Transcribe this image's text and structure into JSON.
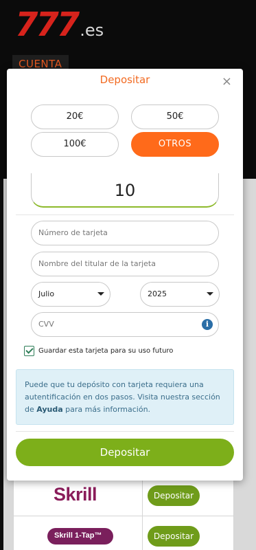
{
  "background": {
    "logo_number": "777",
    "logo_domain": ".es",
    "account_label": "CUENTA",
    "payment_methods": [
      {
        "name": "Skrill",
        "button_label": "Depositar"
      },
      {
        "name": "Skrill 1-Tap™",
        "button_label": "Depositar"
      }
    ]
  },
  "modal": {
    "title": "Depositar",
    "close_glyph": "×",
    "amount_options": [
      {
        "label": "20€",
        "selected": false
      },
      {
        "label": "50€",
        "selected": false
      },
      {
        "label": "100€",
        "selected": false
      },
      {
        "label": "OTROS",
        "selected": true
      }
    ],
    "amount_value": "10",
    "card_number_placeholder": "Número de tarjeta",
    "card_holder_placeholder": "Nombre del titular de la tarjeta",
    "expiry_month": "Julio",
    "expiry_year": "2025",
    "cvv_placeholder": "CVV",
    "save_card": {
      "checked": true,
      "label": "Guardar esta tarjeta para su uso futuro"
    },
    "info": {
      "text_before": "Puede que tu depósito con tarjeta requiera una autentificación en dos pasos. Visita nuestra sección de ",
      "help_link": "Ayuda",
      "text_after": " para más información."
    },
    "submit_label": "Depositar"
  },
  "colors": {
    "accent_orange": "#ff6a1a",
    "primary_green": "#7daf1a",
    "brand_red": "#d7231c",
    "info_blue": "#dff0f7"
  }
}
